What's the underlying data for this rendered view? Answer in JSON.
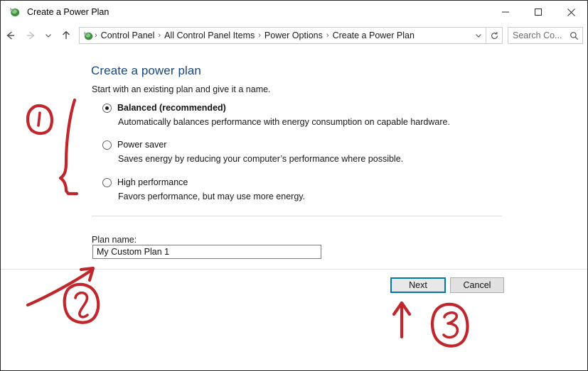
{
  "window": {
    "title": "Create a Power Plan",
    "icon": "power-plug-icon",
    "minimize_label": "—",
    "maximize_label": "□",
    "close_label": "✕"
  },
  "navigation": {
    "back_label": "←",
    "forward_label": "→",
    "recent_label": "⌄",
    "up_label": "↑",
    "address_icon": "power-plug-icon",
    "breadcrumbs": [
      "Control Panel",
      "All Control Panel Items",
      "Power Options",
      "Create a Power Plan"
    ],
    "separator": "›",
    "dropdown_label": "⌄",
    "refresh_label": "↻",
    "search_placeholder": "Search Co...",
    "search_value": ""
  },
  "main": {
    "heading": "Create a power plan",
    "subheading": "Start with an existing plan and give it a name.",
    "options": [
      {
        "label": "Balanced (recommended)",
        "description": "Automatically balances performance with energy consumption on capable hardware.",
        "selected": true
      },
      {
        "label": "Power saver",
        "description": "Saves energy by reducing your computer’s performance where possible.",
        "selected": false
      },
      {
        "label": "High performance",
        "description": "Favors performance, but may use more energy.",
        "selected": false
      }
    ],
    "plan_name_label": "Plan name:",
    "plan_name_value": "My Custom Plan 1",
    "plan_name_placeholder": ""
  },
  "footer": {
    "next_label": "Next",
    "cancel_label": "Cancel"
  },
  "annotations": {
    "color": "#c0272d",
    "marks": [
      {
        "number": "1",
        "target": "power-plan-options-group"
      },
      {
        "number": "2",
        "target": "plan-name-input"
      },
      {
        "number": "3",
        "target": "next-button"
      }
    ]
  }
}
